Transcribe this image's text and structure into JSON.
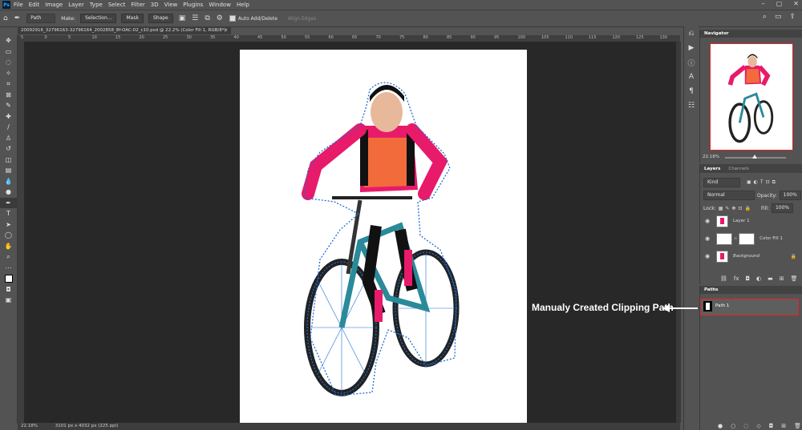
{
  "app": {
    "logo": "Ps"
  },
  "menu": [
    "File",
    "Edit",
    "Image",
    "Layer",
    "Type",
    "Select",
    "Filter",
    "3D",
    "View",
    "Plugins",
    "Window",
    "Help"
  ],
  "options": {
    "mode_select": "Path",
    "make_label": "Make:",
    "selection_btn": "Selection...",
    "mask_btn": "Mask",
    "shape_btn": "Shape",
    "auto_add_delete": "Auto Add/Delete",
    "align_edges": "Align Edges"
  },
  "document": {
    "tab_title": "20092916_32796163-32796164_2002858_8f-OAC-02_c10.psd @ 22.2% (Color Fill 1, RGB/8*)",
    "close": "×"
  },
  "ruler_ticks": [
    "5",
    "0",
    "5",
    "10",
    "15",
    "20",
    "25",
    "30",
    "35",
    "40",
    "45",
    "50",
    "55",
    "60",
    "65",
    "70",
    "75",
    "80",
    "85",
    "90",
    "95",
    "100",
    "105",
    "110",
    "115",
    "120",
    "125",
    "130"
  ],
  "status": {
    "zoom": "22.18%",
    "doc_info": "3101 px x 4032 px (225 ppi)"
  },
  "navigator": {
    "title": "Navigator",
    "zoom": "22.18%"
  },
  "layers": {
    "tabs": [
      "Layers",
      "Channels"
    ],
    "kind_label": "Kind",
    "blend_mode": "Normal",
    "opacity_label": "Opacity:",
    "opacity": "100%",
    "lock_label": "Lock:",
    "fill_label": "Fill:",
    "fill": "100%",
    "items": [
      {
        "name": "Layer 1"
      },
      {
        "name": "Color Fill 1"
      },
      {
        "name": "Background"
      }
    ]
  },
  "paths": {
    "title": "Paths",
    "items": [
      {
        "name": "Path 1"
      }
    ]
  },
  "annotation": "Manualy Created Clipping Path",
  "colors": {
    "highlight_red": "#e3242b",
    "path_blue": "#1f6fd6",
    "jersey_pink": "#e81a6a",
    "jersey_orange": "#f26b3a",
    "bike_teal": "#2a8a9a"
  },
  "icons": [
    "home-icon",
    "pen-tool-icon",
    "gear-icon",
    "search-icon",
    "eye-icon",
    "lock-icon",
    "trash-icon",
    "fx-icon",
    "mask-icon",
    "folder-icon",
    "new-layer-icon",
    "arrow-left-icon"
  ]
}
